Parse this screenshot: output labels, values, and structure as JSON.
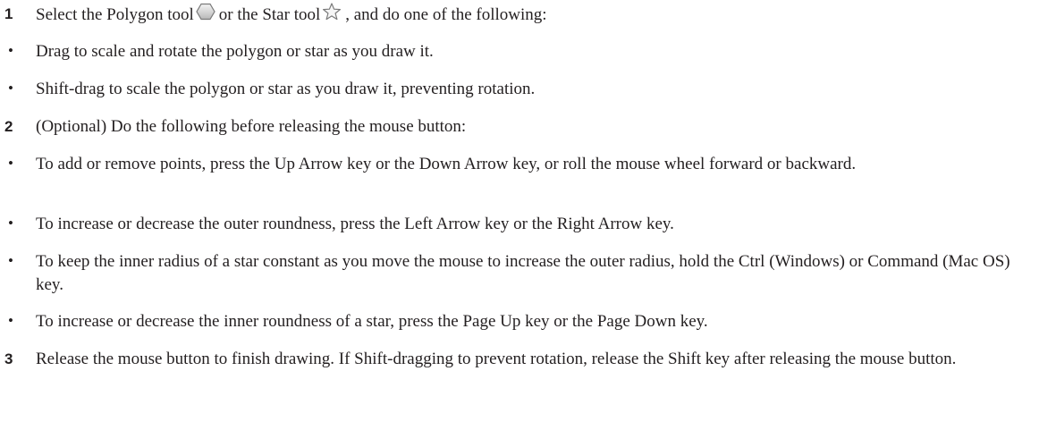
{
  "steps": [
    {
      "number": "1",
      "text_before_polygon": "Select the Polygon tool",
      "text_between": "or the Star tool",
      "text_after_star": ", and do one of the following:",
      "polygon_icon": "polygon-tool-icon",
      "star_icon": "star-tool-icon",
      "bullets": [
        "Drag to scale and rotate the polygon or star as you draw it.",
        "Shift-drag to scale the polygon or star as you draw it, preventing rotation."
      ]
    },
    {
      "number": "2",
      "text": "(Optional) Do the following before releasing the mouse button:",
      "bullets": [
        "To add or remove points, press the Up Arrow key or the Down Arrow key, or roll the mouse wheel forward or backward.",
        "To increase or decrease the outer roundness, press the Left Arrow key or the Right Arrow key.",
        "To keep the inner radius of a star constant as you move the mouse to increase the outer radius, hold the Ctrl (Windows) or Command (Mac OS) key.",
        "To increase or decrease the inner roundness of a star, press the Page Up key or the Page Down key."
      ]
    },
    {
      "number": "3",
      "text": "Release the mouse button to finish drawing. If Shift-dragging to prevent rotation, release the Shift key after releasing the mouse button."
    }
  ],
  "bullet_glyph": "•"
}
